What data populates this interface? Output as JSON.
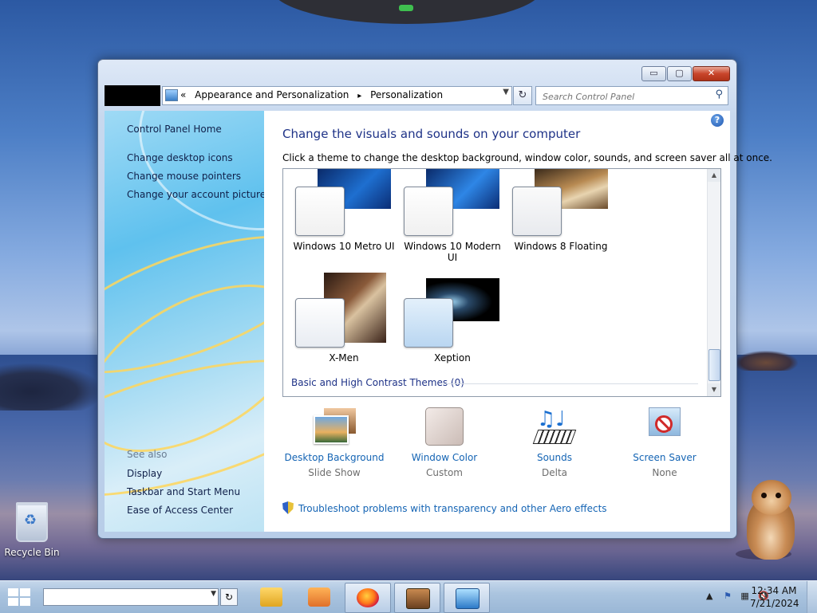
{
  "desktop": {
    "recycle_bin_label": "Recycle Bin"
  },
  "window": {
    "caption_buttons": {
      "minimize": "▭",
      "maximize": "▢",
      "close": "✕"
    },
    "address": {
      "breadcrumb_prefix": "«",
      "crumbs": [
        "Appearance and Personalization",
        "Personalization"
      ],
      "separator": "▸"
    },
    "search_placeholder": "Search Control Panel",
    "sidebar": {
      "home": "Control Panel Home",
      "links": [
        "Change desktop icons",
        "Change mouse pointers",
        "Change your account picture"
      ],
      "see_also_title": "See also",
      "see_also": [
        "Display",
        "Taskbar and Start Menu",
        "Ease of Access Center"
      ]
    },
    "main": {
      "title": "Change the visuals and sounds on your computer",
      "description": "Click a theme to change the desktop background, window color, sounds, and screen saver all at once.",
      "themes": [
        {
          "name": "Windows 10 Metro UI"
        },
        {
          "name": "Windows 10 Modern UI"
        },
        {
          "name": "Windows 8 Floating"
        },
        {
          "name": "X-Men"
        },
        {
          "name": "Xeption"
        }
      ],
      "section_label": "Basic and High Contrast Themes (0)",
      "options": [
        {
          "label": "Desktop Background",
          "value": "Slide Show",
          "icon": "desktop-background-icon"
        },
        {
          "label": "Window Color",
          "value": "Custom",
          "icon": "window-color-icon"
        },
        {
          "label": "Sounds",
          "value": "Delta",
          "icon": "sounds-icon"
        },
        {
          "label": "Screen Saver",
          "value": "None",
          "icon": "screen-saver-icon"
        }
      ],
      "troubleshoot": "Troubleshoot problems with transparency and other Aero effects",
      "help": "?"
    }
  },
  "taskbar": {
    "apps": [
      "file-explorer",
      "media-player",
      "firefox",
      "box-app",
      "control-panel"
    ],
    "clock_time": "12:34 AM",
    "clock_date": "7/21/2024"
  },
  "colors": {
    "link": "#1464b4",
    "heading": "#1e3287",
    "close_button": "#c9452b"
  }
}
